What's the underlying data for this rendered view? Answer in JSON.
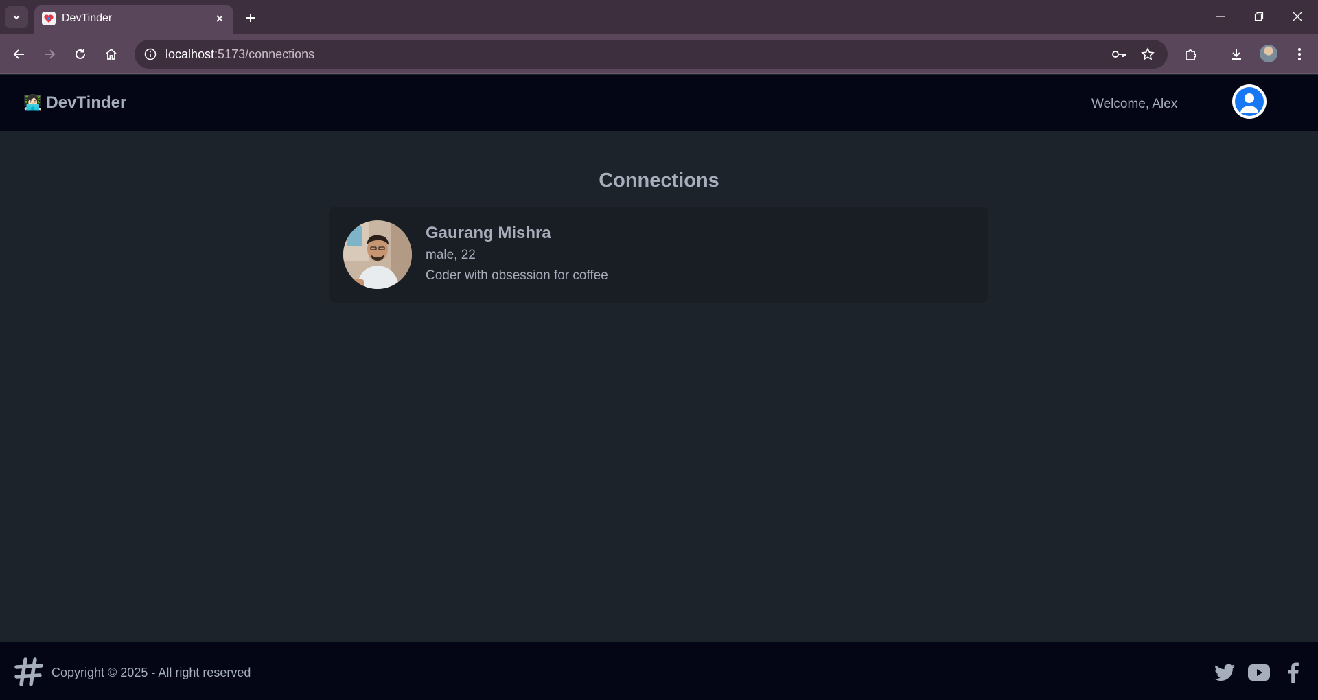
{
  "browser": {
    "tab_title": "DevTinder",
    "url_host": "localhost",
    "url_rest": ":5173/connections"
  },
  "navbar": {
    "brand_emoji": "👩🏻‍💻",
    "brand_name": "DevTinder",
    "welcome_text": "Welcome, Alex"
  },
  "main": {
    "title": "Connections",
    "connections": [
      {
        "name": "Gaurang Mishra",
        "meta": "male, 22",
        "about": "Coder with obsession for coffee"
      }
    ]
  },
  "footer": {
    "copyright": "Copyright © 2025 - All right reserved"
  },
  "colors": {
    "navbar_bg": "#040616",
    "page_bg": "#1d232a",
    "card_bg": "#191e24",
    "text": "#a6adbb",
    "avatar_accent": "#1877f2"
  }
}
